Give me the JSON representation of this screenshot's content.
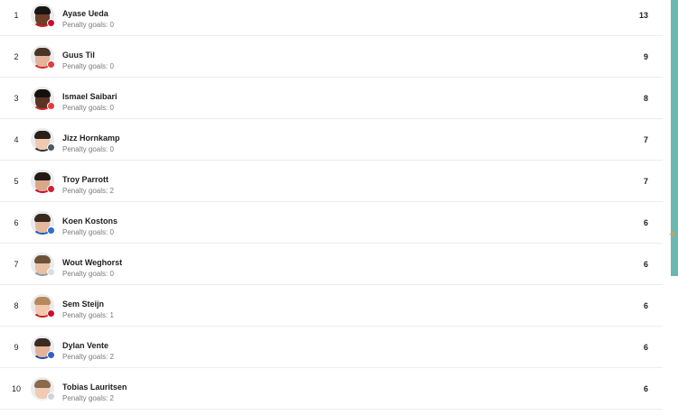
{
  "players": [
    {
      "rank": "1",
      "name": "Ayase Ueda",
      "penalty_text": "Penalty goals: 0",
      "goals": "13",
      "skin": "#6b3f2a",
      "hair": "#1a1412",
      "shirt": "#cc1d1d",
      "badge": "#c8102e"
    },
    {
      "rank": "2",
      "name": "Guus Til",
      "penalty_text": "Penalty goals: 0",
      "goals": "9",
      "skin": "#e2b49a",
      "hair": "#4a3426",
      "shirt": "#d7262e",
      "badge": "#e63a3a"
    },
    {
      "rank": "3",
      "name": "Ismael Saibari",
      "penalty_text": "Penalty goals: 0",
      "goals": "8",
      "skin": "#5a3523",
      "hair": "#17110e",
      "shirt": "#d7262e",
      "badge": "#e63a3a"
    },
    {
      "rank": "4",
      "name": "Jizz Hornkamp",
      "penalty_text": "Penalty goals: 0",
      "goals": "7",
      "skin": "#f0c9ae",
      "hair": "#2b2018",
      "shirt": "#2d3338",
      "badge": "#4a5a66"
    },
    {
      "rank": "5",
      "name": "Troy Parrott",
      "penalty_text": "Penalty goals: 2",
      "goals": "7",
      "skin": "#d9a78a",
      "hair": "#241a14",
      "shirt": "#c8102e",
      "badge": "#d01f2d"
    },
    {
      "rank": "6",
      "name": "Koen Kostons",
      "penalty_text": "Penalty goals: 0",
      "goals": "6",
      "skin": "#e6b99e",
      "hair": "#3a2a1e",
      "shirt": "#1e5bb8",
      "badge": "#2a6fd4"
    },
    {
      "rank": "7",
      "name": "Wout Weghorst",
      "penalty_text": "Penalty goals: 0",
      "goals": "6",
      "skin": "#e8c0a4",
      "hair": "#6e5236",
      "shirt": "#8b9aaa",
      "badge": "#d8dde3"
    },
    {
      "rank": "8",
      "name": "Sem Steijn",
      "penalty_text": "Penalty goals: 1",
      "goals": "6",
      "skin": "#f1c7ad",
      "hair": "#b58a5a",
      "shirt": "#cc1d1d",
      "badge": "#c8102e"
    },
    {
      "rank": "9",
      "name": "Dylan Vente",
      "penalty_text": "Penalty goals: 2",
      "goals": "6",
      "skin": "#e3b297",
      "hair": "#3b2a1f",
      "shirt": "#1f4fa8",
      "badge": "#2c63c9"
    },
    {
      "rank": "10",
      "name": "Tobias Lauritsen",
      "penalty_text": "Penalty goals: 2",
      "goals": "6",
      "skin": "#f0cab2",
      "hair": "#8a6a4a",
      "shirt": "#f2f2f2",
      "badge": "#cfd5db"
    }
  ]
}
